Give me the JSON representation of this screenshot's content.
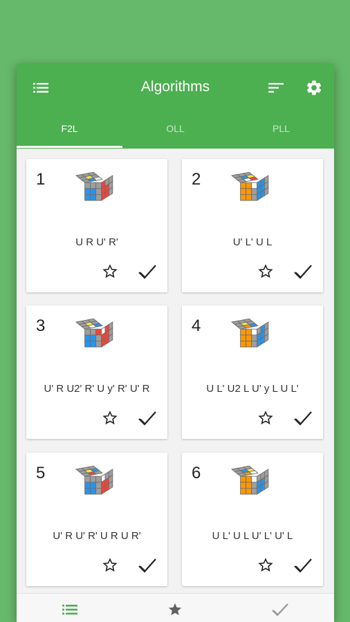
{
  "app": {
    "title": "Algorithms"
  },
  "toolbar": {
    "menu_icon": "list-icon",
    "sort_icon": "sort-icon",
    "settings_icon": "gear-icon"
  },
  "tabs": [
    {
      "label": "F2L",
      "selected": true
    },
    {
      "label": "OLL",
      "selected": false
    },
    {
      "label": "PLL",
      "selected": false
    }
  ],
  "cards": [
    {
      "number": "1",
      "algorithm": "U R U' R'"
    },
    {
      "number": "2",
      "algorithm": "U' L' U L"
    },
    {
      "number": "3",
      "algorithm": "U' R U2' R' U y' R' U' R"
    },
    {
      "number": "4",
      "algorithm": "U L' U2 L U' y L U L'"
    },
    {
      "number": "5",
      "algorithm": "U' R U' R' U R U R'"
    },
    {
      "number": "6",
      "algorithm": "U L' U L U' L' U' L"
    }
  ],
  "card_actions": {
    "favorite_icon": "star-outline-icon",
    "learned_icon": "checkmark-icon"
  },
  "bottom_nav": [
    {
      "name": "list-icon",
      "selected": true
    },
    {
      "name": "star-icon",
      "selected": false
    },
    {
      "name": "checkmark-icon",
      "selected": false
    }
  ],
  "colors": {
    "background": "#66b96a",
    "primary": "#4caf50",
    "cube_gray": "#9e9e9e",
    "cube_blue": "#2196f3",
    "cube_red": "#f44336",
    "cube_orange": "#ff9800",
    "cube_yellow": "#ffeb3b",
    "cube_white": "#ffffff"
  }
}
